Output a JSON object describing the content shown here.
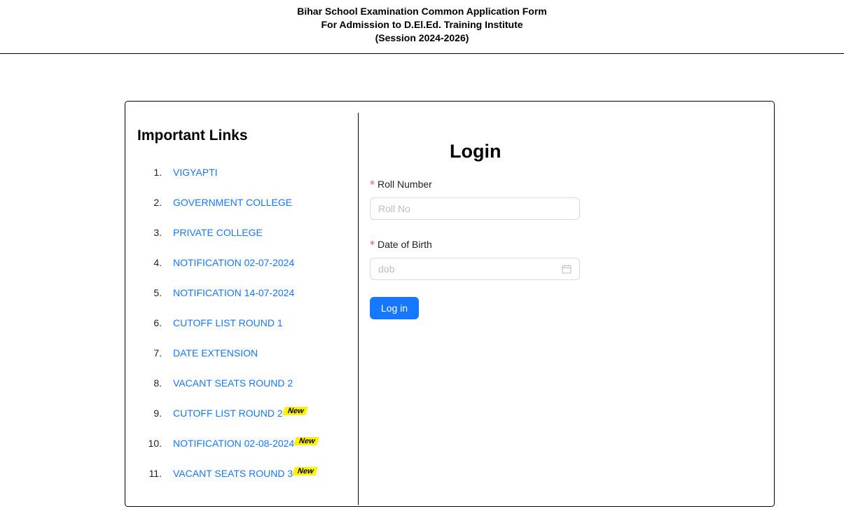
{
  "header": {
    "line1": "Bihar School Examination Common Application Form",
    "line2": "For Admission to D.El.Ed. Training Institute",
    "line3": "(Session 2024-2026)"
  },
  "important_links": {
    "title": "Important Links",
    "badge_text": "New",
    "items": [
      {
        "num": "1.",
        "label": "VIGYAPTI",
        "new": false
      },
      {
        "num": "2.",
        "label": "GOVERNMENT COLLEGE",
        "new": false
      },
      {
        "num": "3.",
        "label": "PRIVATE COLLEGE",
        "new": false
      },
      {
        "num": "4.",
        "label": "NOTIFICATION 02-07-2024",
        "new": false
      },
      {
        "num": "5.",
        "label": "NOTIFICATION 14-07-2024",
        "new": false
      },
      {
        "num": "6.",
        "label": "CUTOFF LIST ROUND 1",
        "new": false
      },
      {
        "num": "7.",
        "label": "DATE EXTENSION",
        "new": false
      },
      {
        "num": "8.",
        "label": "VACANT SEATS ROUND 2",
        "new": false
      },
      {
        "num": "9.",
        "label": "CUTOFF LIST ROUND 2",
        "new": true
      },
      {
        "num": "10.",
        "label": "NOTIFICATION 02-08-2024",
        "new": true
      },
      {
        "num": "11.",
        "label": "VACANT SEATS ROUND 3",
        "new": true
      }
    ]
  },
  "login": {
    "title": "Login",
    "required_mark": "*",
    "roll_label": "Roll Number",
    "roll_placeholder": "Roll No",
    "roll_value": "",
    "dob_label": "Date of Birth",
    "dob_placeholder": "dob",
    "dob_value": "",
    "submit_label": "Log in"
  },
  "colors": {
    "link": "#1677ff",
    "button": "#1677ff",
    "badge": "#fff200",
    "required": "#ff4d4f"
  },
  "icons": {
    "dob_icon": "calendar-icon"
  }
}
